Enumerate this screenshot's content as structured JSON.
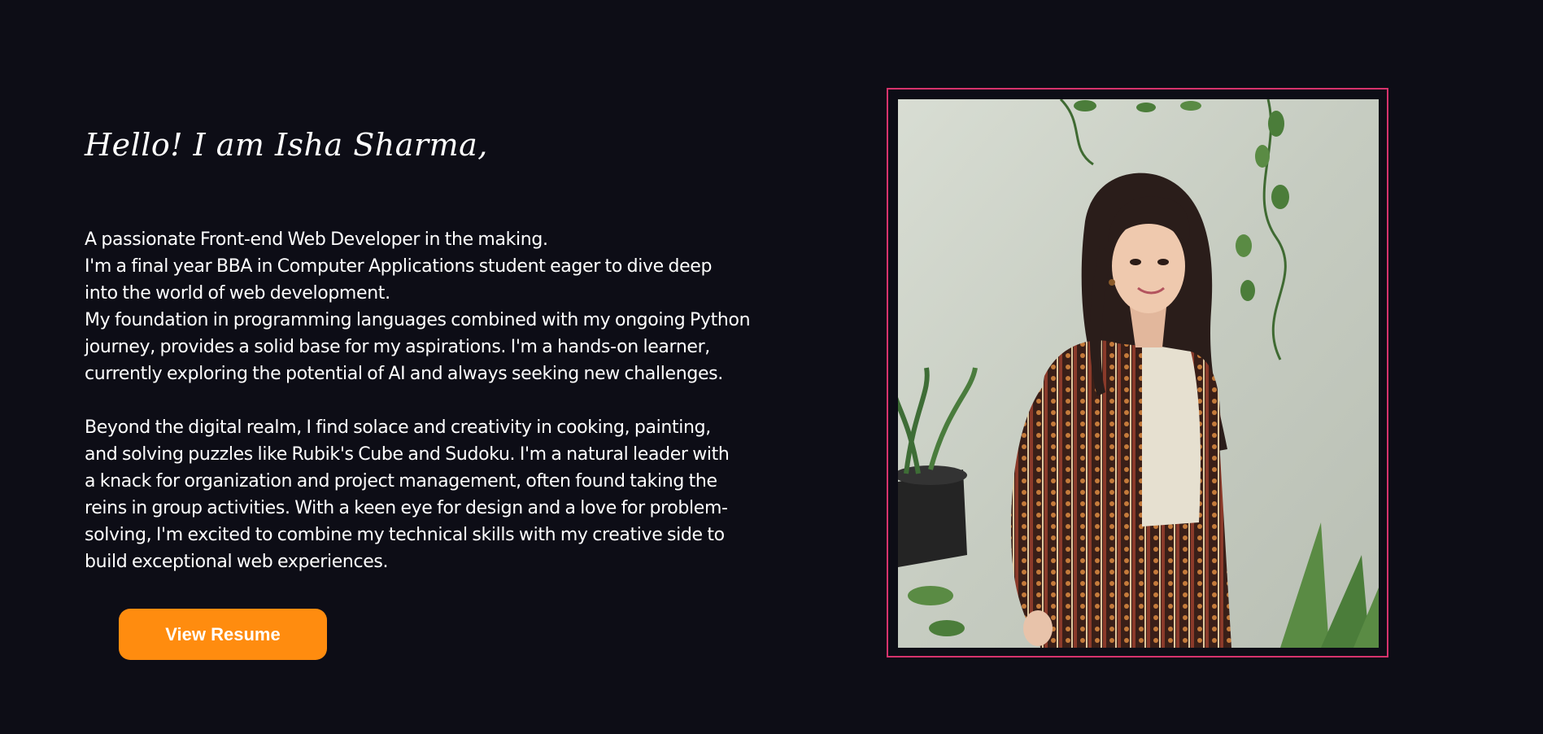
{
  "hero": {
    "greeting": "Hello! I am Isha Sharma,",
    "bio_lines_1": [
      "A passionate Front-end Web Developer in the making.",
      "I'm a final year BBA in Computer Applications student eager to dive deep",
      "into the world of web development.",
      "My foundation in programming languages combined with my ongoing Python",
      "journey, provides a solid base for my aspirations. I'm a hands-on learner,",
      "currently exploring the potential of AI and always seeking new challenges."
    ],
    "bio_lines_2": [
      "Beyond the digital realm, I find solace and creativity in cooking, painting,",
      "and solving puzzles like Rubik's Cube and Sudoku. I'm a natural leader with",
      "a knack for organization and project management, often found taking the",
      "reins in group activities. With a keen eye for design and a love for problem-",
      "solving, I'm excited to combine my technical skills with my creative side to",
      "build exceptional web experiences."
    ],
    "resume_button_label": "View Resume"
  },
  "colors": {
    "background": "#0d0d16",
    "accent_button": "#ff8c0f",
    "frame_border": "#d6336c",
    "text": "#ffffff"
  },
  "photo": {
    "subject": "portrait-photo"
  }
}
